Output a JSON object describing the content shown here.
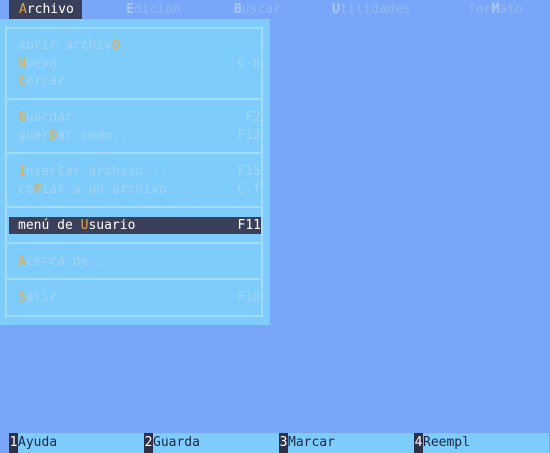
{
  "menubar": {
    "items": [
      {
        "hotkey": "A",
        "rest": "rchivo"
      },
      {
        "hotkey": "E",
        "rest": "dición"
      },
      {
        "hotkey": "B",
        "rest": "uscar"
      },
      {
        "hotkey": "U",
        "rest": "tilidades"
      },
      {
        "pre": "for",
        "hotkey": "M",
        "rest": "ato"
      }
    ]
  },
  "dropdown": {
    "items": [
      {
        "pre": "abrir archiv",
        "hotkey": "O",
        "rest": "...",
        "key": ""
      },
      {
        "pre": "",
        "hotkey": "N",
        "rest": "uevo",
        "key": "C-n"
      },
      {
        "pre": "",
        "hotkey": "C",
        "rest": "errar",
        "key": ""
      },
      {
        "pre": "",
        "hotkey": "G",
        "rest": "uardar",
        "key": "F2"
      },
      {
        "pre": "guar",
        "hotkey": "D",
        "rest": "ar como...",
        "key": "F12"
      },
      {
        "pre": "",
        "hotkey": "I",
        "rest": "nsertar archivo...",
        "key": "F15"
      },
      {
        "pre": "co",
        "hotkey": "P",
        "rest": "iar a un archivo...",
        "key": "C-f"
      },
      {
        "pre": "menú de ",
        "hotkey": "U",
        "rest": "suario",
        "key": "F11"
      },
      {
        "pre": "",
        "hotkey": "A",
        "rest": "cerca de...",
        "key": ""
      },
      {
        "pre": "",
        "hotkey": "S",
        "rest": "alir",
        "key": "F10"
      }
    ]
  },
  "function_keys": [
    {
      "num": "1",
      "label": "Ayuda"
    },
    {
      "num": "2",
      "label": "Guarda"
    },
    {
      "num": "3",
      "label": "Marcar"
    },
    {
      "num": "4",
      "label": "Reempl"
    }
  ],
  "colors": {
    "desktop": "#7aa6fa",
    "menu_bg": "#7dccfc",
    "highlight_bg": "#3a3f5a",
    "hotkey": "#e3a443"
  }
}
